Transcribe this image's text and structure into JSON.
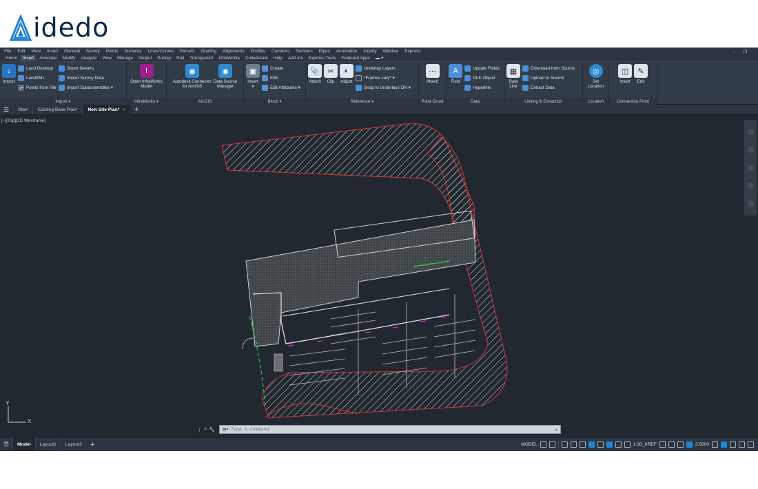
{
  "logo": {
    "text": "idedo"
  },
  "menubar": {
    "items": [
      "File",
      "Edit",
      "View",
      "Insert",
      "General",
      "Survey",
      "Points",
      "Surfaces",
      "Lines/Curves",
      "Parcels",
      "Grading",
      "Alignments",
      "Profiles",
      "Corridors",
      "Sections",
      "Pipes",
      "Annotation",
      "Inquiry",
      "Window",
      "Express"
    ]
  },
  "ribbon_tabs": {
    "items": [
      "Home",
      "Insert",
      "Annotate",
      "Modify",
      "Analyze",
      "View",
      "Manage",
      "Output",
      "Survey",
      "Rail",
      "Transparent",
      "InfraWorks",
      "Collaborate",
      "Help",
      "Add-ins",
      "Express Tools",
      "Featured Apps"
    ],
    "active": "Insert"
  },
  "ribbon": {
    "import": {
      "title": "Import",
      "big": "Import",
      "land_desktop": "Land Desktop",
      "landxml": "LandXML",
      "points_from_file": "Points from File",
      "storm_sewers": "Storm Sewers",
      "import_survey_data": "Import Survey Data",
      "import_subassemblies": "Import Subassemblies"
    },
    "infraworks": {
      "title": "InfraWorks",
      "open_model": "Open InfraWorks\nModel"
    },
    "arcgis": {
      "title": "ArcGIS",
      "connector": "Autodesk Connector\nfor ArcGIS",
      "datasource": "Data Source\nManager"
    },
    "block": {
      "title": "Block",
      "insert": "Insert",
      "create": "Create",
      "edit": "Edit",
      "edit_attributes": "Edit Attributes"
    },
    "reference": {
      "title": "Reference",
      "attach": "Attach",
      "clip": "Clip",
      "adjust": "Adjust",
      "underlay_layers": "Underlay Layers",
      "frames_vary": "*Frames vary*",
      "snap_underlays": "Snap to Underlays ON"
    },
    "pointcloud": {
      "title": "Point Cloud",
      "attach": "Attach"
    },
    "data": {
      "title": "Data",
      "field": "Field",
      "update_fields": "Update Fields",
      "ole_object": "OLE Object",
      "hyperlink": "Hyperlink"
    },
    "linking": {
      "title": "Linking & Extraction",
      "data_link": "Data\nLink",
      "download": "Download from Source",
      "upload": "Upload to Source",
      "extract": "Extract  Data"
    },
    "location": {
      "title": "Location",
      "set_location": "Set\nLocation"
    },
    "connection": {
      "title": "Connection Point",
      "insert": "Insert",
      "edit": "Edit"
    }
  },
  "doc_tabs": {
    "items": [
      "Start",
      "Existing Base Plan*",
      "New Site Plan*"
    ],
    "active": "New Site Plan*"
  },
  "viewport": {
    "label": "[−][Top][2D Wireframe]",
    "ucs_y": "Y",
    "ucs_x": "X"
  },
  "command": {
    "placeholder": "Type a command"
  },
  "layout_tabs": {
    "items": [
      "Model",
      "Layout1",
      "Layout2"
    ],
    "active": "Model"
  },
  "status": {
    "model": "MODEL",
    "scale": "1:30_XREF",
    "value": "3.5000"
  },
  "colors": {
    "accent": "#1f87d6",
    "background": "#212830",
    "ribbon": "#323c48",
    "hatch": "#c8c8c8",
    "boundary": "#d8383c",
    "green": "#26c24a",
    "magenta": "#d02bd0"
  }
}
